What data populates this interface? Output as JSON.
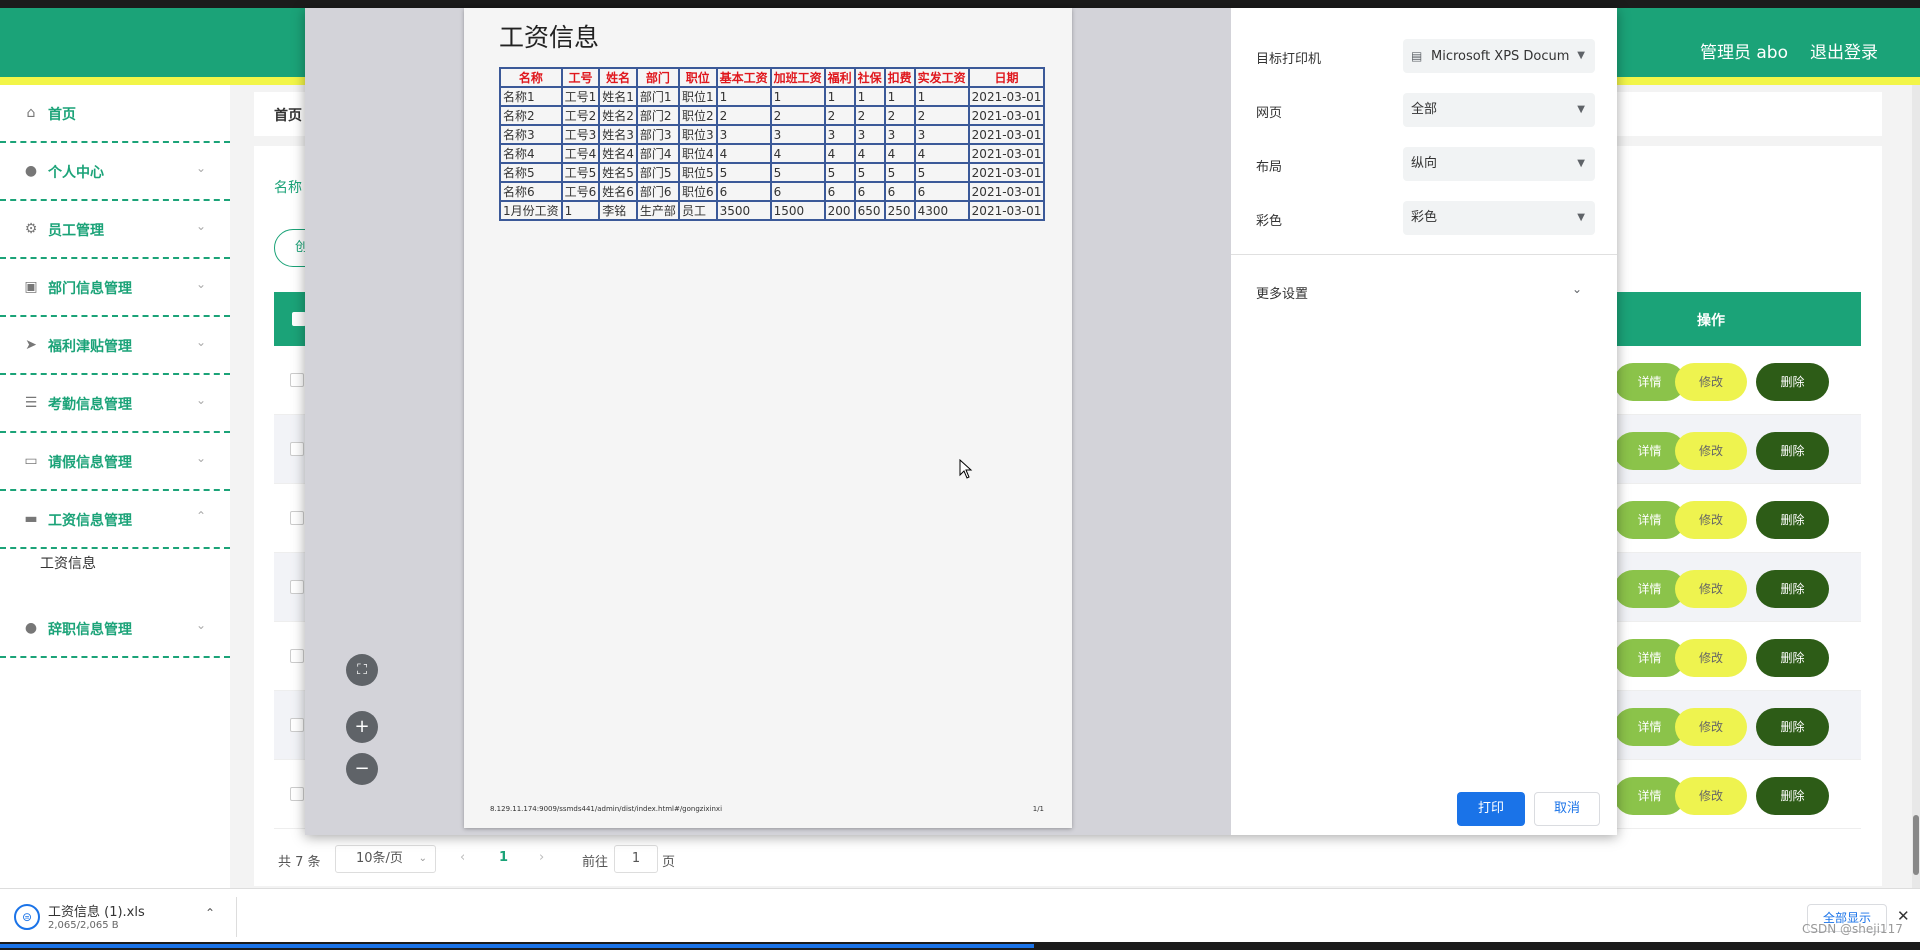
{
  "header": {
    "user": "管理员 abo",
    "logout": "退出登录",
    "brand_color": "#1ba378",
    "accent_color": "#f2f548"
  },
  "sidebar": {
    "items": [
      {
        "label": "首页",
        "icon": "home-icon",
        "expandable": false
      },
      {
        "label": "个人中心",
        "icon": "user-icon",
        "expandable": true
      },
      {
        "label": "员工管理",
        "icon": "gear-icon",
        "expandable": true
      },
      {
        "label": "部门信息管理",
        "icon": "clipboard-icon",
        "expandable": true
      },
      {
        "label": "福利津贴管理",
        "icon": "send-icon",
        "expandable": true
      },
      {
        "label": "考勤信息管理",
        "icon": "list-icon",
        "expandable": true
      },
      {
        "label": "请假信息管理",
        "icon": "message-icon",
        "expandable": true
      },
      {
        "label": "工资信息管理",
        "icon": "monitor-icon",
        "expandable": true,
        "expanded": true
      },
      {
        "label": "辞职信息管理",
        "icon": "user-icon",
        "expandable": true
      }
    ],
    "sub_item": "工资信息"
  },
  "breadcrumb": "首页",
  "search": {
    "label": "名称"
  },
  "add_button": "创",
  "table": {
    "action_header": "操作",
    "row_count": 7,
    "buttons": {
      "detail": "详情",
      "edit": "修改",
      "delete": "删除"
    }
  },
  "pager": {
    "total": "共 7 条",
    "page_size": "10条/页",
    "current_page": "1",
    "goto_prefix": "前往",
    "goto_value": "1",
    "goto_suffix": "页"
  },
  "print_dialog": {
    "doc_title": "工资信息",
    "columns": [
      "名称",
      "工号",
      "姓名",
      "部门",
      "职位",
      "基本工资",
      "加班工资",
      "福利",
      "社保",
      "扣费",
      "实发工资",
      "日期"
    ],
    "rows": [
      [
        "名称1",
        "工号1",
        "姓名1",
        "部门1",
        "职位1",
        "1",
        "1",
        "1",
        "1",
        "1",
        "1",
        "2021-03-01"
      ],
      [
        "名称2",
        "工号2",
        "姓名2",
        "部门2",
        "职位2",
        "2",
        "2",
        "2",
        "2",
        "2",
        "2",
        "2021-03-01"
      ],
      [
        "名称3",
        "工号3",
        "姓名3",
        "部门3",
        "职位3",
        "3",
        "3",
        "3",
        "3",
        "3",
        "3",
        "2021-03-01"
      ],
      [
        "名称4",
        "工号4",
        "姓名4",
        "部门4",
        "职位4",
        "4",
        "4",
        "4",
        "4",
        "4",
        "4",
        "2021-03-01"
      ],
      [
        "名称5",
        "工号5",
        "姓名5",
        "部门5",
        "职位5",
        "5",
        "5",
        "5",
        "5",
        "5",
        "5",
        "2021-03-01"
      ],
      [
        "名称6",
        "工号6",
        "姓名6",
        "部门6",
        "职位6",
        "6",
        "6",
        "6",
        "6",
        "6",
        "6",
        "2021-03-01"
      ],
      [
        "1月份工资",
        "1",
        "李铭",
        "生产部",
        "员工",
        "3500",
        "1500",
        "200",
        "650",
        "250",
        "4300",
        "2021-03-01"
      ]
    ],
    "footer_url": "8.129.11.174:9009/ssmds441/admin/dist/index.html#/gongzixinxi",
    "footer_page": "1/1",
    "settings": {
      "printer_label": "目标打印机",
      "printer_value": "Microsoft XPS Docum",
      "pages_label": "网页",
      "pages_value": "全部",
      "layout_label": "布局",
      "layout_value": "纵向",
      "color_label": "彩色",
      "color_value": "彩色",
      "more_settings": "更多设置"
    },
    "print_button": "打印",
    "cancel_button": "取消"
  },
  "download_bar": {
    "file_name": "工资信息 (1).xls",
    "file_size": "2,065/2,065 B",
    "show_all": "全部显示"
  },
  "watermark": "CSDN @sheji117"
}
